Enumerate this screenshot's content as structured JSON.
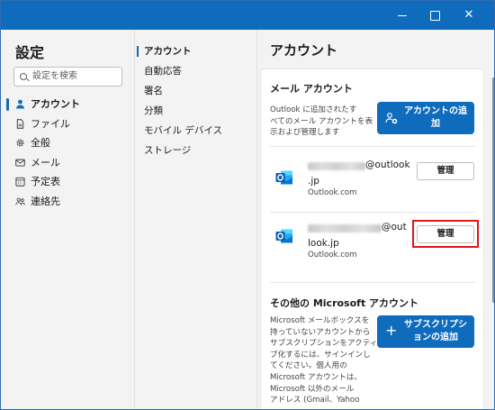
{
  "window": {
    "controls": {
      "minimize_icon": "minimize-icon",
      "maximize_icon": "maximize-icon",
      "close_glyph": "✕"
    }
  },
  "left_nav": {
    "title": "設定",
    "search": {
      "placeholder": "設定を検索",
      "icon": "search-icon"
    },
    "items": [
      {
        "label": "アカウント",
        "icon": "person-icon",
        "active": true
      },
      {
        "label": "ファイル",
        "icon": "file-icon"
      },
      {
        "label": "全般",
        "icon": "gear-icon"
      },
      {
        "label": "メール",
        "icon": "mail-icon"
      },
      {
        "label": "予定表",
        "icon": "calendar-icon"
      },
      {
        "label": "連絡先",
        "icon": "contacts-icon"
      }
    ]
  },
  "mid_menu": {
    "items": [
      {
        "label": "アカウント",
        "active": true
      },
      {
        "label": "自動応答"
      },
      {
        "label": "署名"
      },
      {
        "label": "分類"
      },
      {
        "label": "モバイル デバイス"
      },
      {
        "label": "ストレージ"
      }
    ]
  },
  "right_panel": {
    "title": "アカウント",
    "mail_accounts": {
      "title": "メール アカウント",
      "desc": [
        "Outlook に追加されたす",
        "べてのメール アカウントを表",
        "示および管理します"
      ],
      "add_button": {
        "line1": "アカウントの追",
        "line2": "加",
        "icon": "add-account-icon"
      },
      "accounts": [
        {
          "email_suffix": "@outlook",
          "email_suffix2": ".jp",
          "provider": "Outlook.com",
          "manage_label": "管理"
        },
        {
          "email_suffix": "@out",
          "email_suffix2": "look.jp",
          "provider": "Outlook.com",
          "manage_label": "管理"
        }
      ]
    },
    "other_accounts": {
      "title": "その他の Microsoft アカウント",
      "desc": [
        "Microsoft メールボックスを",
        "持っていないアカウントから",
        "サブスクリプションをアクティ",
        "ブ化するには、サインインし",
        "てください。個人用の",
        "Microsoft アカウントは、",
        "Microsoft 以外のメール",
        "アドレス (Gmail、Yahoo"
      ],
      "sub_button": {
        "line1": "サブスクリプシ",
        "line2": "ョンの追加",
        "glyph": "+"
      }
    }
  },
  "colors": {
    "accent": "#0f6cbd",
    "highlight": "#e0161b"
  }
}
